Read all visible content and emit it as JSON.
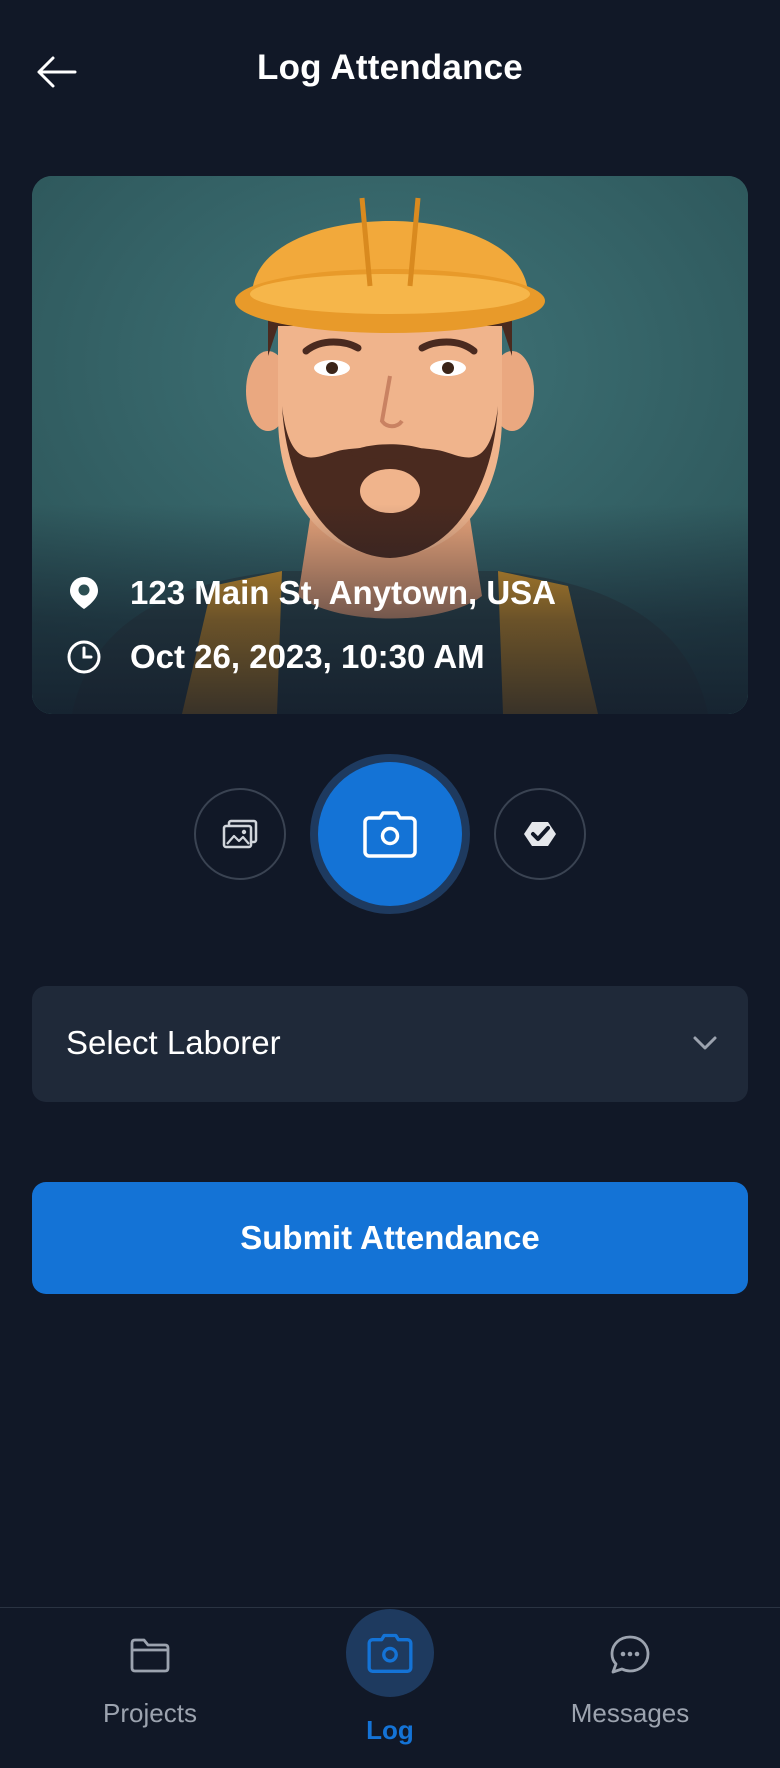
{
  "header": {
    "title": "Log Attendance",
    "back_icon": "arrow-left-icon"
  },
  "photo": {
    "location": "123 Main St, Anytown, USA",
    "timestamp": "Oct 26, 2023, 10:30 AM",
    "location_icon": "map-pin-icon",
    "time_icon": "clock-icon"
  },
  "controls": {
    "gallery_icon": "gallery-icon",
    "shutter_icon": "camera-icon",
    "flip_icon": "flip-camera-icon"
  },
  "form": {
    "select_placeholder": "Select Laborer",
    "submit_label": "Submit Attendance"
  },
  "nav": {
    "items": [
      {
        "label": "Projects",
        "icon": "folder-icon",
        "active": false
      },
      {
        "label": "Log",
        "icon": "camera-icon",
        "active": true
      },
      {
        "label": "Messages",
        "icon": "chat-bubble-icon",
        "active": false
      }
    ]
  },
  "colors": {
    "background": "#111827",
    "accent": "#1473d6",
    "surface": "#1f2939",
    "muted_text": "#9ca3af"
  }
}
